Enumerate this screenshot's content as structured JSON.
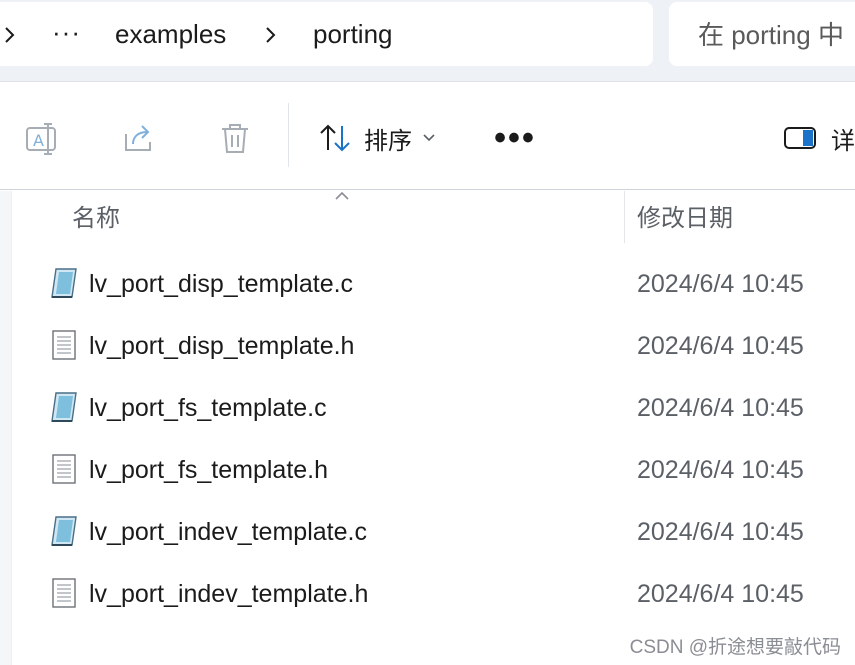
{
  "breadcrumb": {
    "overflow": "···",
    "items": [
      "examples",
      "porting"
    ]
  },
  "search": {
    "placeholder": "在 porting 中"
  },
  "toolbar": {
    "rename_icon": "rename-icon",
    "share_icon": "share-icon",
    "delete_icon": "trash-icon",
    "sort_label": "排序",
    "more_label": "•••",
    "details_label": "详"
  },
  "columns": {
    "name": "名称",
    "modified": "修改日期"
  },
  "files": [
    {
      "name": "lv_port_disp_template.c",
      "modified": "2024/6/4 10:45",
      "icon": "c-source-file-icon"
    },
    {
      "name": "lv_port_disp_template.h",
      "modified": "2024/6/4 10:45",
      "icon": "header-file-icon"
    },
    {
      "name": "lv_port_fs_template.c",
      "modified": "2024/6/4 10:45",
      "icon": "c-source-file-icon"
    },
    {
      "name": "lv_port_fs_template.h",
      "modified": "2024/6/4 10:45",
      "icon": "header-file-icon"
    },
    {
      "name": "lv_port_indev_template.c",
      "modified": "2024/6/4 10:45",
      "icon": "c-source-file-icon"
    },
    {
      "name": "lv_port_indev_template.h",
      "modified": "2024/6/4 10:45",
      "icon": "header-file-icon"
    }
  ],
  "watermark": "CSDN @折途想要敲代码",
  "colors": {
    "accent": "#1a73c8",
    "disabled_icon": "#a7adb4",
    "header_text": "#5b5f66"
  }
}
